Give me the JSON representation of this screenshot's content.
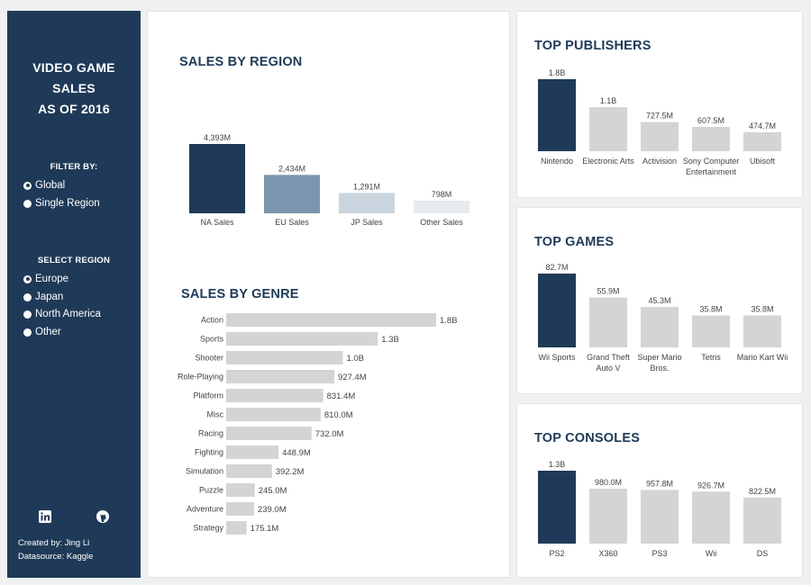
{
  "sidebar": {
    "title_lines": [
      "VIDEO GAME",
      "SALES",
      "AS OF 2016"
    ],
    "filter_label": "FILTER BY:",
    "filter_options": [
      {
        "label": "Global",
        "selected": true
      },
      {
        "label": "Single Region",
        "selected": false
      }
    ],
    "region_label": "SELECT REGION",
    "region_options": [
      {
        "label": "Europe",
        "selected": true
      },
      {
        "label": "Japan",
        "selected": false
      },
      {
        "label": "North America",
        "selected": false
      },
      {
        "label": "Other",
        "selected": false
      }
    ],
    "icons": [
      "linkedin-icon",
      "github-icon"
    ],
    "created_by": "Created by: Jing Li",
    "datasource": "Datasource: Kaggle"
  },
  "colors": {
    "navy": "#1f3a58",
    "steel": "#7a95ad",
    "light_blue": "#c9d4de",
    "very_light": "#e7ebee",
    "grey": "#d4d4d4",
    "text": "#444444"
  },
  "chart_data": [
    {
      "id": "region",
      "type": "bar",
      "title": "SALES BY REGION",
      "categories": [
        "NA Sales",
        "EU Sales",
        "JP Sales",
        "Other Sales"
      ],
      "values": [
        4393,
        2434,
        1291,
        798
      ],
      "value_labels": [
        "4,393M",
        "2,434M",
        "1,291M",
        "798M"
      ],
      "colors": [
        "#1f3a58",
        "#7a95ad",
        "#c9d4de",
        "#e7ebee"
      ],
      "unit": "M"
    },
    {
      "id": "genre",
      "type": "bar",
      "orientation": "horizontal",
      "title": "SALES BY GENRE",
      "categories": [
        "Action",
        "Sports",
        "Shooter",
        "Role-Playing",
        "Platform",
        "Misc",
        "Racing",
        "Fighting",
        "Simulation",
        "Puzzle",
        "Adventure",
        "Strategy"
      ],
      "values": [
        1800,
        1300,
        1000,
        927.4,
        831.4,
        810.0,
        732.0,
        448.9,
        392.2,
        245.0,
        239.0,
        175.1
      ],
      "value_labels": [
        "1.8B",
        "1.3B",
        "1.0B",
        "927.4M",
        "831.4M",
        "810.0M",
        "732.0M",
        "448.9M",
        "392.2M",
        "245.0M",
        "239.0M",
        "175.1M"
      ],
      "unit": "M"
    },
    {
      "id": "publishers",
      "type": "bar",
      "title": "TOP PUBLISHERS",
      "categories": [
        [
          "Nintendo"
        ],
        [
          "Electronic Arts"
        ],
        [
          "Activision"
        ],
        [
          "Sony Computer",
          "Entertainment"
        ],
        [
          "Ubisoft"
        ]
      ],
      "values": [
        1800,
        1100,
        727.5,
        607.5,
        474.7
      ],
      "value_labels": [
        "1.8B",
        "1.1B",
        "727.5M",
        "607.5M",
        "474.7M"
      ],
      "highlight": 0,
      "unit": "M"
    },
    {
      "id": "games",
      "type": "bar",
      "title": "TOP GAMES",
      "categories": [
        [
          "Wii Sports"
        ],
        [
          "Grand Theft",
          "Auto V"
        ],
        [
          "Super Mario",
          "Bros."
        ],
        [
          "Tetris"
        ],
        [
          "Mario Kart Wii"
        ]
      ],
      "values": [
        82.7,
        55.9,
        45.3,
        35.8,
        35.8
      ],
      "value_labels": [
        "82.7M",
        "55.9M",
        "45.3M",
        "35.8M",
        "35.8M"
      ],
      "highlight": 0,
      "unit": "M"
    },
    {
      "id": "consoles",
      "type": "bar",
      "title": "TOP CONSOLES",
      "categories": [
        [
          "PS2"
        ],
        [
          "X360"
        ],
        [
          "PS3"
        ],
        [
          "Wii"
        ],
        [
          "DS"
        ]
      ],
      "values": [
        1300,
        980.0,
        957.8,
        926.7,
        822.5
      ],
      "value_labels": [
        "1.3B",
        "980.0M",
        "957.8M",
        "926.7M",
        "822.5M"
      ],
      "highlight": 0,
      "unit": "M"
    }
  ]
}
